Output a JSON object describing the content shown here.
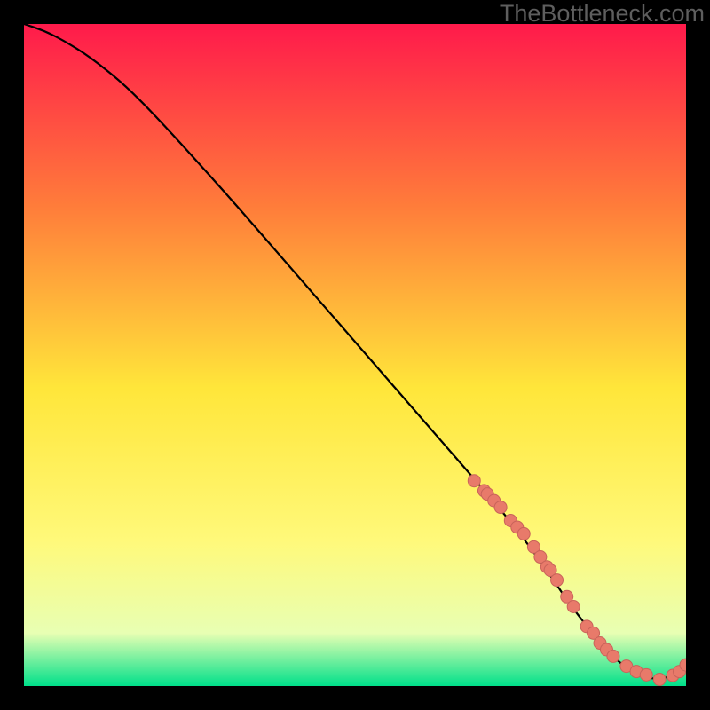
{
  "watermark": "TheBottleneck.com",
  "colors": {
    "background": "#000000",
    "gradient_top": "#ff1a4b",
    "gradient_mid_upper": "#ff7e3a",
    "gradient_mid": "#ffe63a",
    "gradient_mid_lower": "#fff97a",
    "gradient_lower": "#e8ffb3",
    "gradient_bottom": "#00e08a",
    "curve": "#000000",
    "marker_fill": "#e87a6a",
    "marker_stroke": "#c9635a"
  },
  "chart_data": {
    "type": "line",
    "title": "",
    "xlabel": "",
    "ylabel": "",
    "xlim": [
      0,
      100
    ],
    "ylim": [
      0,
      100
    ],
    "curve": {
      "x": [
        0,
        3,
        6,
        10,
        15,
        20,
        30,
        40,
        50,
        60,
        70,
        75,
        80,
        82,
        85,
        88,
        90,
        92,
        94,
        96,
        98,
        100
      ],
      "y": [
        100,
        99,
        97.5,
        95,
        91,
        86,
        75,
        63.5,
        52,
        40.5,
        29,
        23,
        16,
        13,
        9,
        5.5,
        3.5,
        2.2,
        1.3,
        1.0,
        1.6,
        3.2
      ]
    },
    "markers": {
      "x": [
        68,
        69.5,
        70,
        71,
        72,
        73.5,
        74.5,
        75.5,
        77,
        78,
        79,
        79.5,
        80.5,
        82,
        83,
        85,
        86,
        87,
        88,
        89,
        91,
        92.5,
        94,
        96,
        98,
        99,
        100
      ],
      "y": [
        31,
        29.5,
        29,
        28,
        27,
        25,
        24,
        23,
        21,
        19.5,
        18,
        17.5,
        16,
        13.5,
        12,
        9,
        8,
        6.5,
        5.5,
        4.5,
        3,
        2.2,
        1.7,
        1.0,
        1.6,
        2.2,
        3.2
      ]
    }
  }
}
